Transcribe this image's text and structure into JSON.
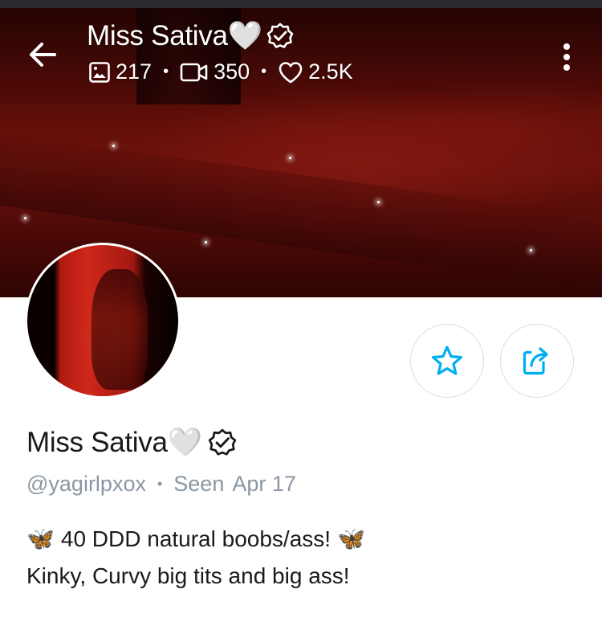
{
  "header": {
    "name": "Miss Sativa🤍",
    "stats": {
      "photos": "217",
      "videos": "350",
      "likes": "2.5K"
    },
    "separator": "•"
  },
  "profile": {
    "name": "Miss Sativa🤍",
    "handle": "@yagirlpxox",
    "separator": "•",
    "seen_label": "Seen",
    "seen_date": "Apr 17",
    "bio": [
      "40 DDD natural boobs/ass!",
      "Kinky, Curvy big tits and big ass!"
    ],
    "bio_emoji": "🦋"
  },
  "colors": {
    "accent": "#00aff0",
    "muted": "#8a96a3",
    "button_border": "#d9dde3"
  }
}
